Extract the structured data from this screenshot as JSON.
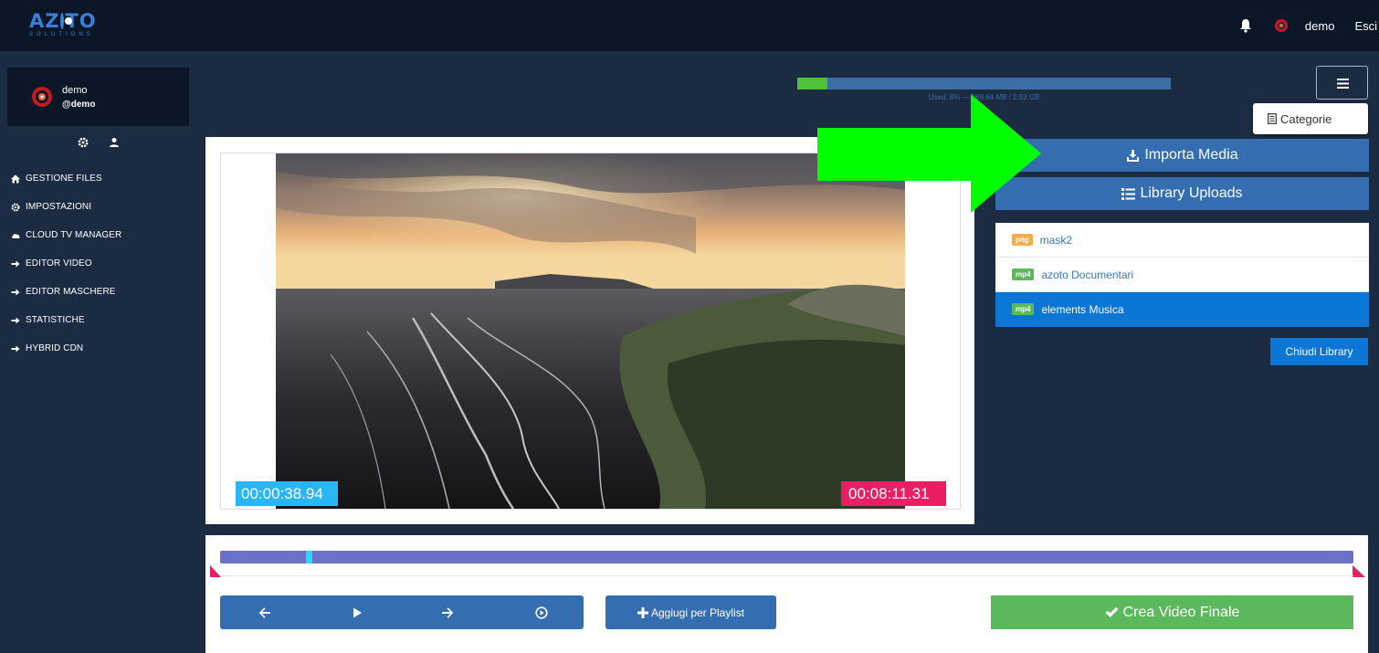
{
  "brand": {
    "logo_main_left": "AZ",
    "logo_main_right": "TO",
    "logo_sub": "SOLUTIONS"
  },
  "topbar": {
    "username": "demo",
    "logout": "Esci"
  },
  "profile": {
    "name": "demo",
    "handle": "@demo"
  },
  "nav": [
    {
      "label": "GESTIONE FILES",
      "icon": "home-icon"
    },
    {
      "label": "IMPOSTAZIONI",
      "icon": "gear-icon"
    },
    {
      "label": "CLOUD TV MANAGER",
      "icon": "cloud-icon"
    },
    {
      "label": "EDITOR VIDEO",
      "icon": "arrow-right-icon"
    },
    {
      "label": "EDITOR MASCHERE",
      "icon": "arrow-right-icon"
    },
    {
      "label": "STATISTICHE",
      "icon": "arrow-right-icon"
    },
    {
      "label": "HYBRID CDN",
      "icon": "arrow-right-icon"
    }
  ],
  "storage": {
    "used_percent": 8,
    "label": "Used: 8% — 269.64 MB / 2.93 GB"
  },
  "menu": {
    "dropdown_item": "Categorie"
  },
  "video": {
    "time_start": "00:00:38.94",
    "time_end": "00:08:11.31"
  },
  "library": {
    "import_label": "Importa Media",
    "uploads_label": "Library Uploads",
    "items": [
      {
        "type": "png",
        "name": "mask2",
        "active": false
      },
      {
        "type": "mp4",
        "name": "azoto Documentari",
        "active": false
      },
      {
        "type": "mp4",
        "name": "elements Musica",
        "active": true
      }
    ],
    "close_label": "Chiudi Library"
  },
  "timeline": {
    "playhead_fraction": 0.076
  },
  "actions": {
    "playlist_label": "Aggiugi per Playlist",
    "final_label": "Crea Video Finale"
  },
  "colors": {
    "primary": "#346eb0",
    "success": "#5cb85c",
    "accent_blue": "#0b76d6",
    "timecode_start": "#29b6f6",
    "timecode_end": "#e91e63",
    "annotation": "#00ff00"
  }
}
